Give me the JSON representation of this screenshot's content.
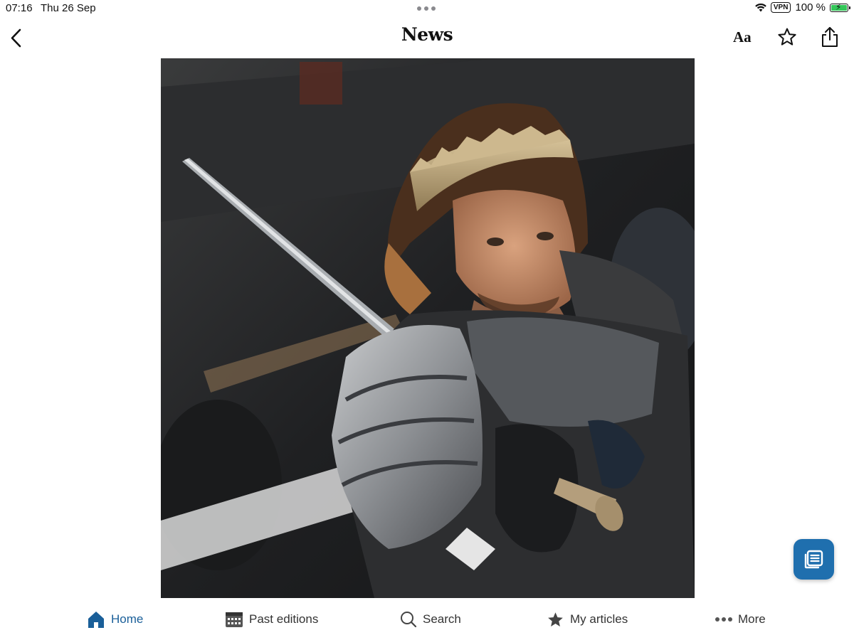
{
  "status_bar": {
    "time": "07:16",
    "date": "Thu 26 Sep",
    "vpn": "VPN",
    "battery": "100 %",
    "battery_level": 1.0,
    "icons": [
      "wifi-icon",
      "battery-charging-icon"
    ]
  },
  "nav": {
    "title": "News",
    "text_size_label": "Aa",
    "icons": [
      "chevron-left-icon",
      "star-outline-icon",
      "share-icon"
    ]
  },
  "article": {
    "image_subject": "photo"
  },
  "floating_button": {
    "icon": "articles-list-icon",
    "color": "#1f6fae"
  },
  "tab_bar": {
    "accent": "#1a5f99",
    "tabs": [
      {
        "label": "Home",
        "icon": "home-icon",
        "active": true
      },
      {
        "label": "Past editions",
        "icon": "calendar-icon",
        "active": false
      },
      {
        "label": "Search",
        "icon": "search-icon",
        "active": false
      },
      {
        "label": "My articles",
        "icon": "star-filled-icon",
        "active": false
      },
      {
        "label": "More",
        "icon": "more-dots-icon",
        "active": false
      }
    ]
  }
}
